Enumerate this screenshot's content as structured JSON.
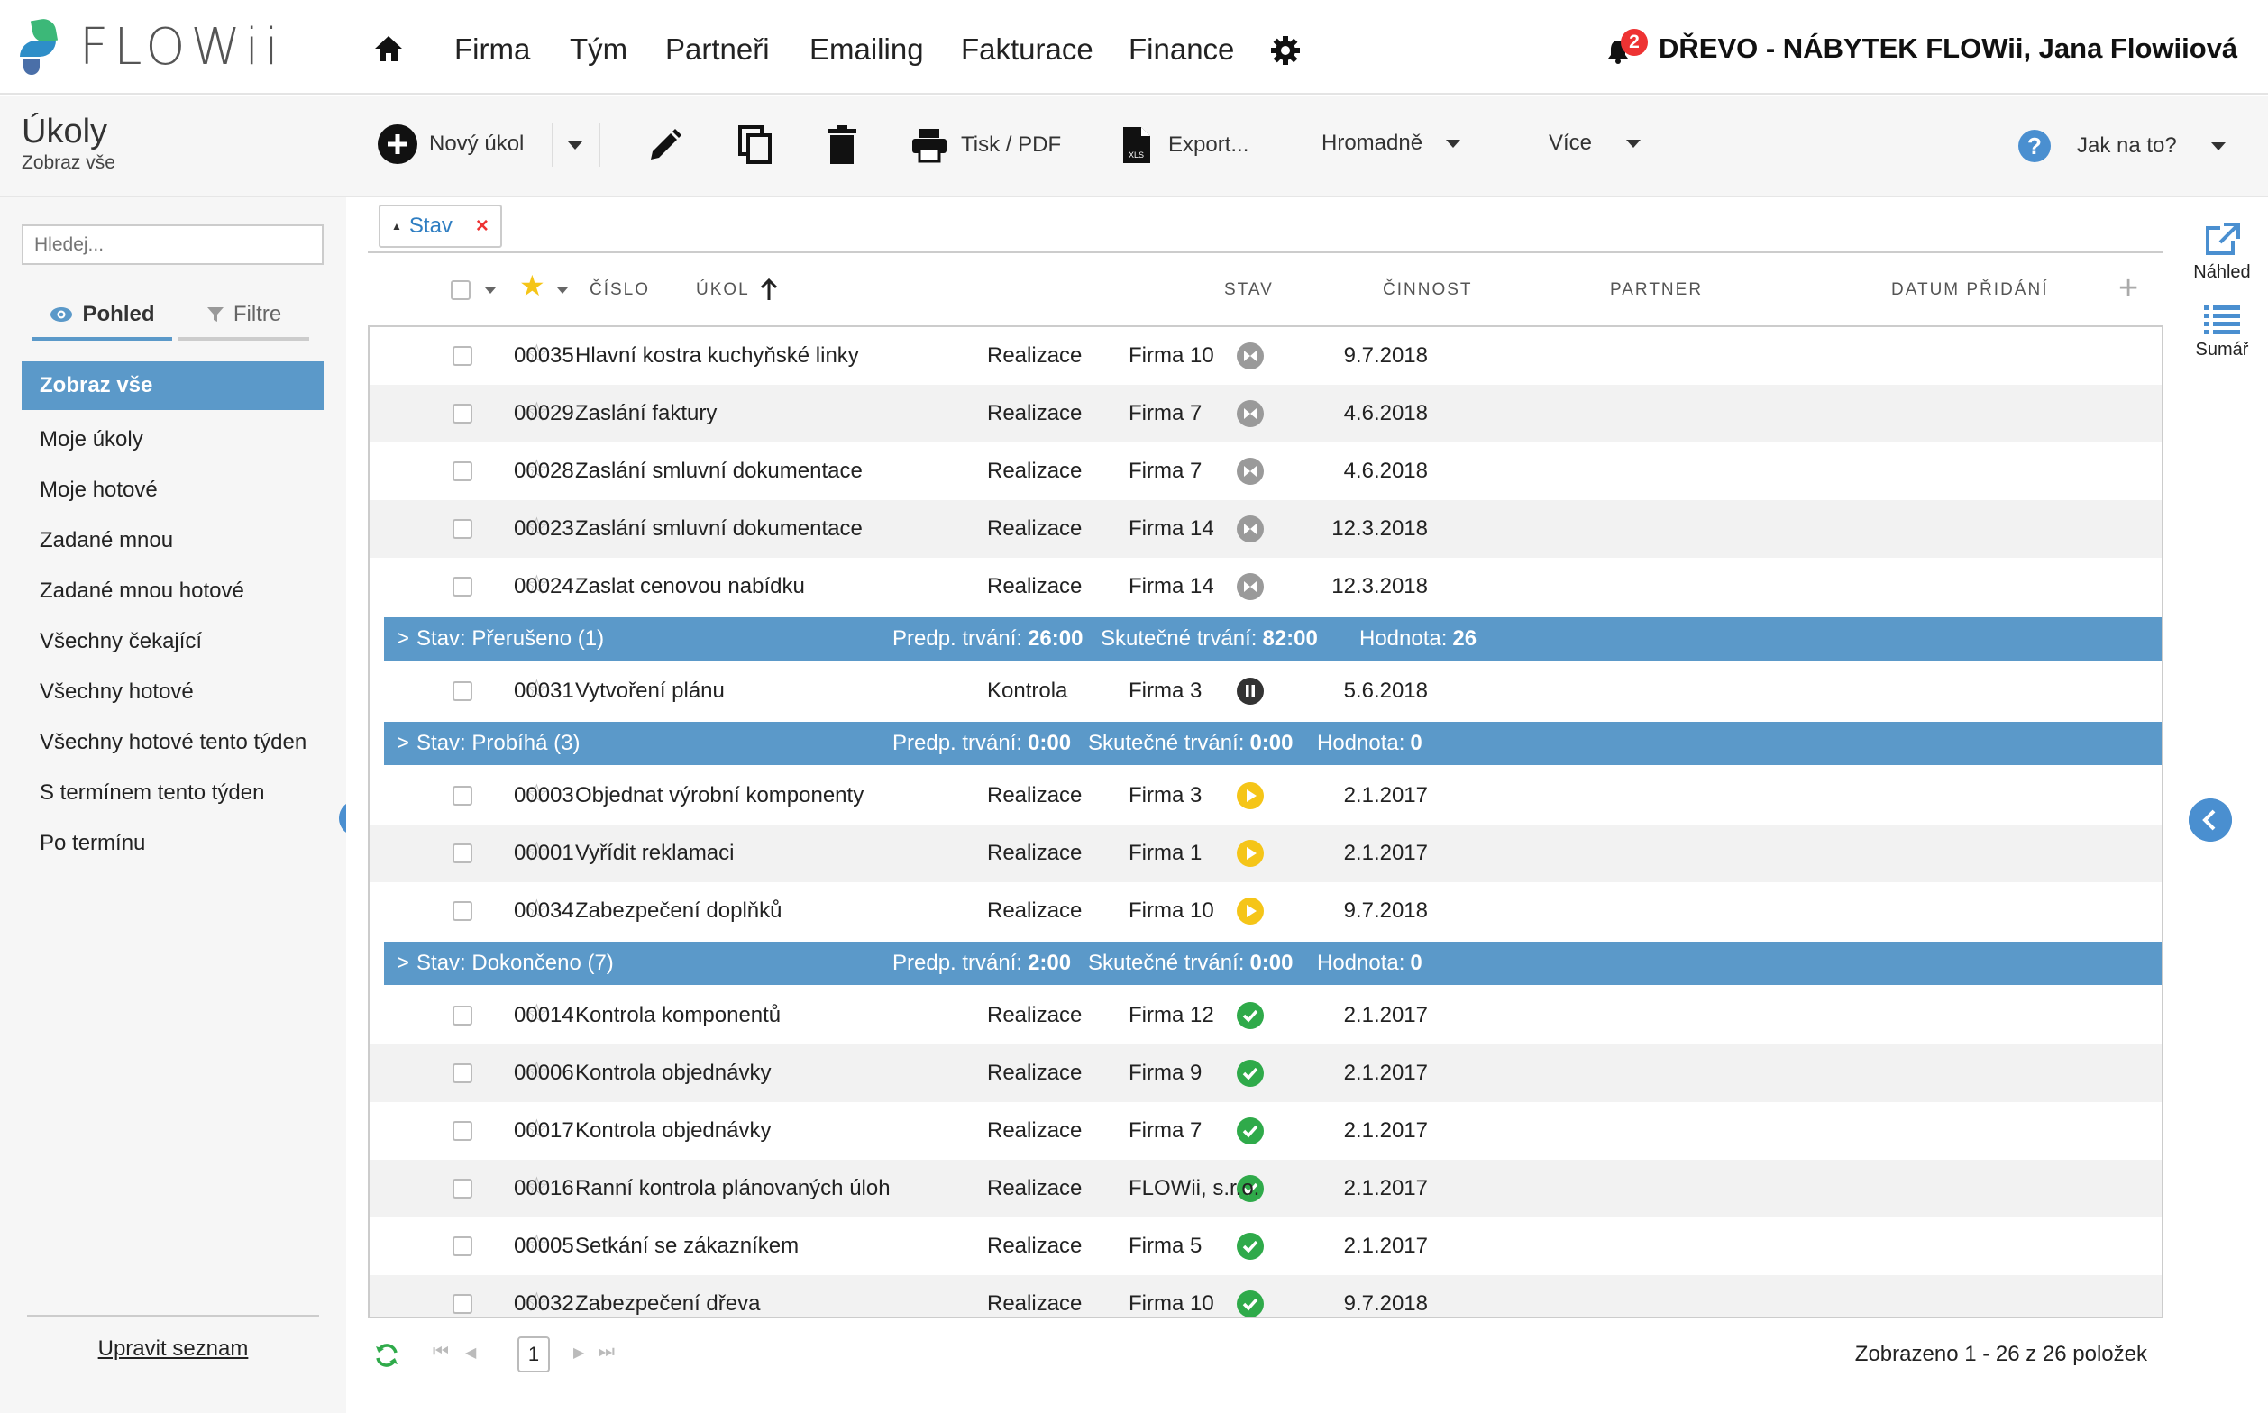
{
  "app": {
    "logo_text": "FLOWii",
    "company_user": "DŘEVO - NÁBYTEK FLOWii, Jana Flowiiová",
    "notification_count": "2"
  },
  "nav": {
    "items": [
      "Firma",
      "Tým",
      "Partneři",
      "Emailing",
      "Fakturace",
      "Finance"
    ]
  },
  "page": {
    "title": "Úkoly",
    "subtitle": "Zobraz vše"
  },
  "toolbar": {
    "new_task": "Nový úkol",
    "print": "Tisk / PDF",
    "export": "Export...",
    "bulk": "Hromadně",
    "more": "Více",
    "help": "Jak na to?"
  },
  "sidebar": {
    "search_placeholder": "Hledej...",
    "tab_view": "Pohled",
    "tab_filter": "Filtre",
    "items": [
      "Zobraz vše",
      "Moje úkoly",
      "Moje hotové",
      "Zadané mnou",
      "Zadané mnou hotové",
      "Všechny čekající",
      "Všechny hotové",
      "Všechny hotové tento týden",
      "S termínem tento týden",
      "Po termínu"
    ],
    "active_index": 0,
    "edit_list": "Upravit seznam"
  },
  "filter_chip": {
    "label": "Stav"
  },
  "columns": {
    "number": "ČÍSLO",
    "task": "ÚKOL",
    "status": "STAV",
    "activity": "ČINNOST",
    "partner": "PARTNER",
    "date_added": "DATUM PŘIDÁNÍ"
  },
  "groups": {
    "g0": {},
    "g1": {
      "label": "Stav: Přerušeno (1)",
      "pred_label": "Predp. trvání:",
      "pred": "26:00",
      "real_label": "Skutečné trvání:",
      "real": "82:00",
      "value_label": "Hodnota:",
      "value": "26"
    },
    "g2": {
      "label": "Stav: Probíhá (3)",
      "pred_label": "Predp. trvání:",
      "pred": "0:00",
      "real_label": "Skutečné trvání:",
      "real": "0:00",
      "value_label": "Hodnota:",
      "value": "0"
    },
    "g3": {
      "label": "Stav: Dokončeno (7)",
      "pred_label": "Predp. trvání:",
      "pred": "2:00",
      "real_label": "Skutečné trvání:",
      "real": "0:00",
      "value_label": "Hodnota:",
      "value": "0"
    }
  },
  "rows": {
    "r0": {
      "num": "00035",
      "task": "Hlavní kostra kuchyňské linky",
      "status": "waiting",
      "activity": "Realizace",
      "partner": "Firma 10",
      "date": "9.7.2018"
    },
    "r1": {
      "num": "00029",
      "task": "Zaslání faktury",
      "status": "waiting",
      "activity": "Realizace",
      "partner": "Firma 7",
      "date": "4.6.2018"
    },
    "r2": {
      "num": "00028",
      "task": "Zaslání smluvní dokumentace",
      "status": "waiting",
      "activity": "Realizace",
      "partner": "Firma 7",
      "date": "4.6.2018"
    },
    "r3": {
      "num": "00023",
      "task": "Zaslání smluvní dokumentace",
      "status": "waiting",
      "activity": "Realizace",
      "partner": "Firma 14",
      "date": "12.3.2018"
    },
    "r4": {
      "num": "00024",
      "task": "Zaslat cenovou nabídku",
      "status": "waiting",
      "activity": "Realizace",
      "partner": "Firma 14",
      "date": "12.3.2018"
    },
    "r5": {
      "num": "00031",
      "task": "Vytvoření plánu",
      "status": "paused",
      "activity": "Kontrola",
      "partner": "Firma 3",
      "date": "5.6.2018"
    },
    "r6": {
      "num": "00003",
      "task": "Objednat výrobní komponenty",
      "status": "running",
      "activity": "Realizace",
      "partner": "Firma 3",
      "date": "2.1.2017"
    },
    "r7": {
      "num": "00001",
      "task": "Vyřídit reklamaci",
      "status": "running",
      "activity": "Realizace",
      "partner": "Firma 1",
      "date": "2.1.2017"
    },
    "r8": {
      "num": "00034",
      "task": "Zabezpečení doplňků",
      "status": "running",
      "activity": "Realizace",
      "partner": "Firma 10",
      "date": "9.7.2018"
    },
    "r9": {
      "num": "00014",
      "task": "Kontrola komponentů",
      "status": "done",
      "activity": "Realizace",
      "partner": "Firma 12",
      "date": "2.1.2017"
    },
    "r10": {
      "num": "00006",
      "task": "Kontrola objednávky",
      "status": "done",
      "activity": "Realizace",
      "partner": "Firma 9",
      "date": "2.1.2017"
    },
    "r11": {
      "num": "00017",
      "task": "Kontrola objednávky",
      "status": "done",
      "activity": "Realizace",
      "partner": "Firma 7",
      "date": "2.1.2017"
    },
    "r12": {
      "num": "00016",
      "task": "Ranní kontrola plánovaných úloh",
      "status": "done",
      "activity": "Realizace",
      "partner": "FLOWii, s.r.o.",
      "date": "2.1.2017"
    },
    "r13": {
      "num": "00005",
      "task": "Setkání se zákazníkem",
      "status": "done",
      "activity": "Realizace",
      "partner": "Firma 5",
      "date": "2.1.2017"
    },
    "r14": {
      "num": "00032",
      "task": "Zabezpečení dřeva",
      "status": "done",
      "activity": "Realizace",
      "partner": "Firma 10",
      "date": "9.7.2018"
    }
  },
  "status_colors": {
    "waiting": "#9a9a9a",
    "paused": "#333333",
    "running": "#f5c518",
    "done": "#2faa4a"
  },
  "pager": {
    "current_page": "1",
    "info": "Zobrazeno 1 - 26 z 26 položek"
  },
  "rail": {
    "preview": "Náhled",
    "summary": "Sumář"
  }
}
